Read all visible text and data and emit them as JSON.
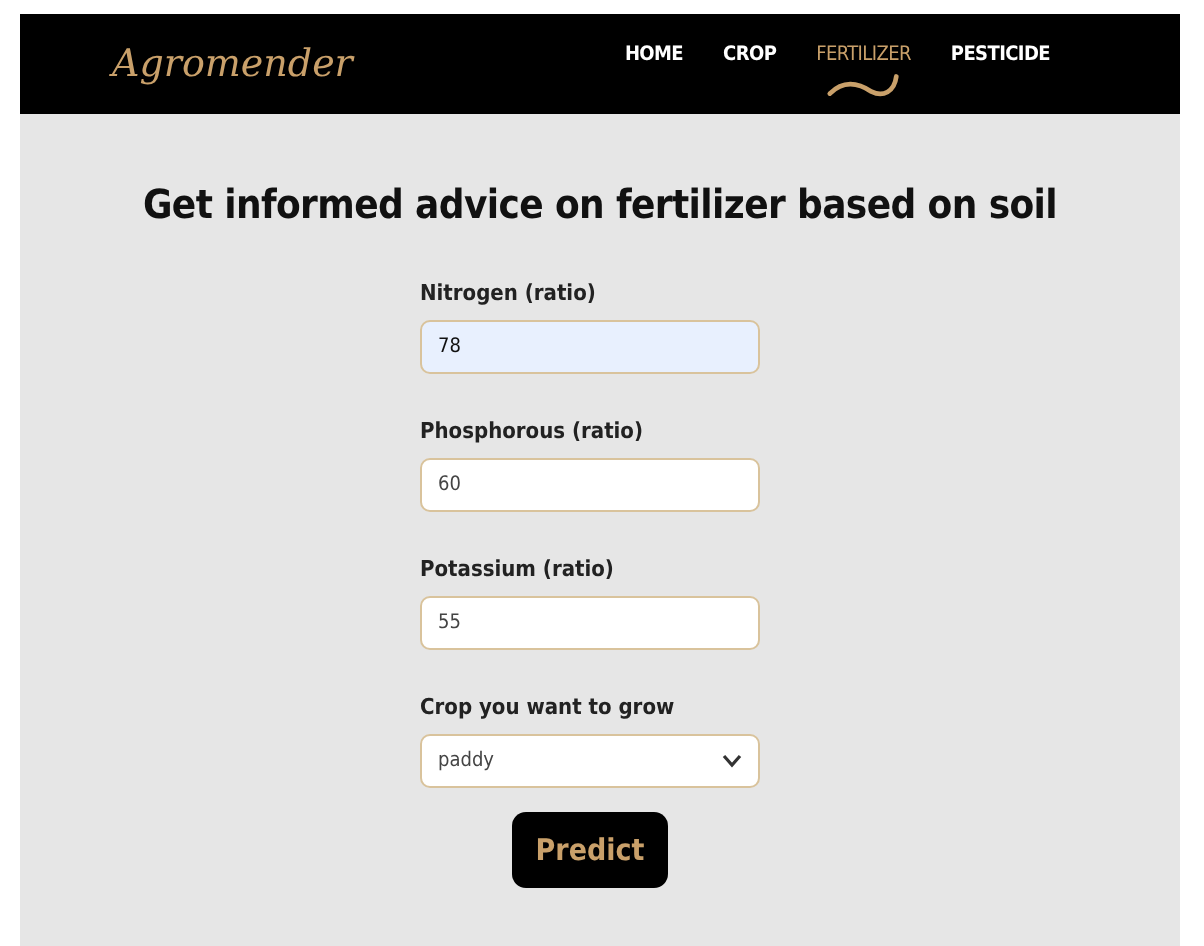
{
  "brand": "Agromender",
  "nav": [
    {
      "label": "HOME",
      "selected": false
    },
    {
      "label": "CROP",
      "selected": false
    },
    {
      "label": "FERTILIZER",
      "selected": true
    },
    {
      "label": "PESTICIDE",
      "selected": false
    }
  ],
  "heading": "Get informed advice on fertilizer based on soil",
  "fields": [
    {
      "kind": "number",
      "label": "Nitrogen (ratio)",
      "value": "78",
      "autofilled": true
    },
    {
      "kind": "number",
      "label": "Phosphorous (ratio)",
      "value": "60",
      "autofilled": false
    },
    {
      "kind": "number",
      "label": "Potassium (ratio)",
      "value": "55",
      "autofilled": false
    },
    {
      "kind": "select",
      "label": "Crop you want to grow",
      "value": "paddy",
      "autofilled": false
    }
  ],
  "submit": "Predict"
}
